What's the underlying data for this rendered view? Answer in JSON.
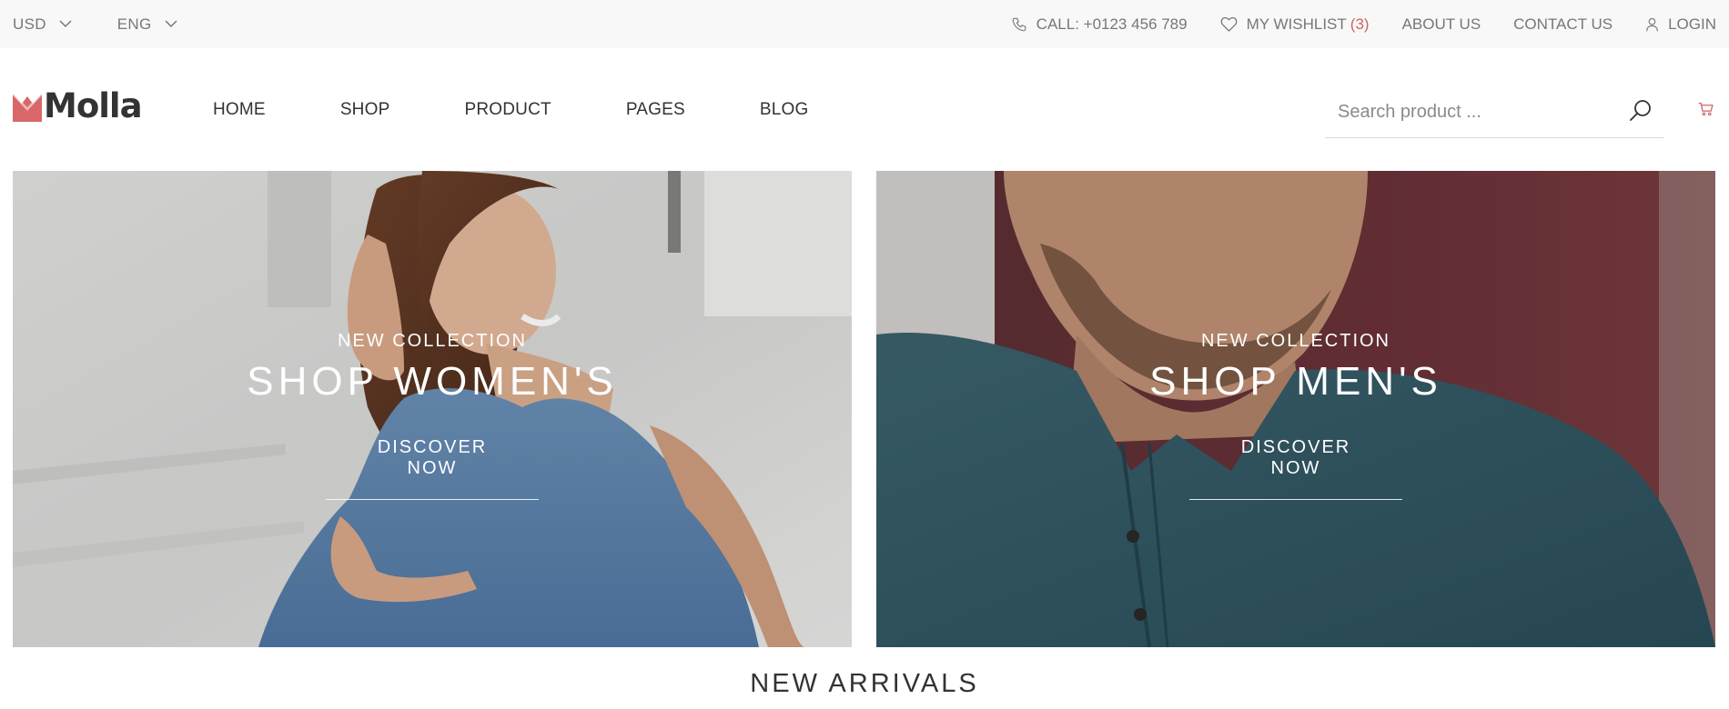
{
  "topbar": {
    "currency": "USD",
    "language": "ENG",
    "call": "CALL: +0123 456 789",
    "wishlist_label": "MY WISHLIST",
    "wishlist_count": "(3)",
    "about": "ABOUT US",
    "contact": "CONTACT US",
    "login": "LOGIN"
  },
  "header": {
    "logo_text": "Molla",
    "nav": [
      "HOME",
      "SHOP",
      "PRODUCT",
      "PAGES",
      "BLOG"
    ],
    "search_placeholder": "Search product ..."
  },
  "banners": [
    {
      "subtitle": "NEW COLLECTION",
      "title": "SHOP WOMEN'S",
      "button": "DISCOVER NOW"
    },
    {
      "subtitle": "NEW COLLECTION",
      "title": "SHOP MEN'S",
      "button": "DISCOVER NOW"
    }
  ],
  "section_title": "NEW ARRIVALS",
  "colors": {
    "accent": "#cc6666",
    "topbar_bg": "#f8f8f8",
    "text_dark": "#333333",
    "text_muted": "#777777"
  },
  "icons": [
    "chevron-down-icon",
    "phone-icon",
    "heart-icon",
    "user-icon",
    "search-icon",
    "cart-icon",
    "logo-mark-icon"
  ]
}
